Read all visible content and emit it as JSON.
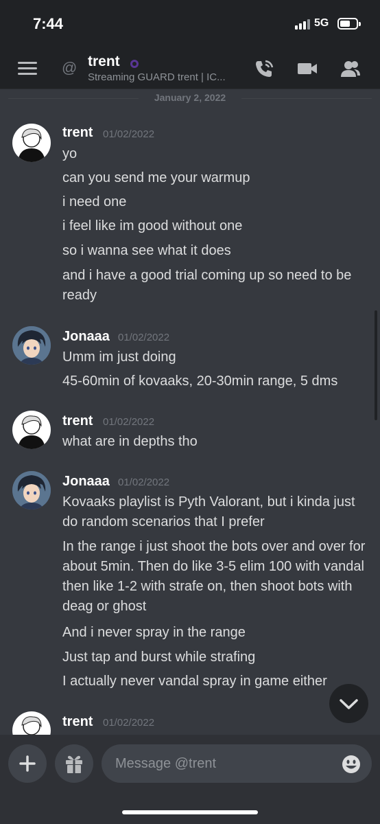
{
  "status_bar": {
    "time": "7:44",
    "network": "5G"
  },
  "header": {
    "name": "trent",
    "status": "Streaming GUARD trent | IC...",
    "presence_color": "#593695"
  },
  "date_divider": "January 2, 2022",
  "messages": [
    {
      "author": "trent",
      "timestamp": "01/02/2022",
      "lines": [
        "yo",
        "can you send me your warmup",
        "i need one",
        "i feel like im good without one",
        "so i wanna see what it does",
        "and i have a good trial coming up so need to be ready"
      ]
    },
    {
      "author": "Jonaaa",
      "timestamp": "01/02/2022",
      "lines": [
        "Umm im just doing",
        "45-60min of kovaaks, 20-30min range, 5 dms"
      ]
    },
    {
      "author": "trent",
      "timestamp": "01/02/2022",
      "lines": [
        "what are in depths tho"
      ]
    },
    {
      "author": "Jonaaa",
      "timestamp": "01/02/2022",
      "lines": [
        "Kovaaks playlist is Pyth Valorant, but i kinda just do random scenarios that I prefer",
        "In the range i just shoot the bots over and over for about 5min. Then do like 3-5 elim 100 with vandal  then like 1-2 with strafe on, then shoot bots with deag or ghost",
        "And i never spray in the range",
        "Just tap and burst while strafing",
        "I actually never vandal spray in game either"
      ]
    },
    {
      "author": "trent",
      "timestamp": "01/02/2022",
      "lines": []
    }
  ],
  "composer": {
    "placeholder": "Message @trent"
  },
  "icons": {
    "menu": "hamburger-icon",
    "at": "at-icon",
    "call": "phone-call-icon",
    "video": "video-icon",
    "members": "members-icon",
    "add": "plus-icon",
    "gift": "gift-icon",
    "emoji": "emoji-icon",
    "jump": "chevron-down-icon"
  }
}
